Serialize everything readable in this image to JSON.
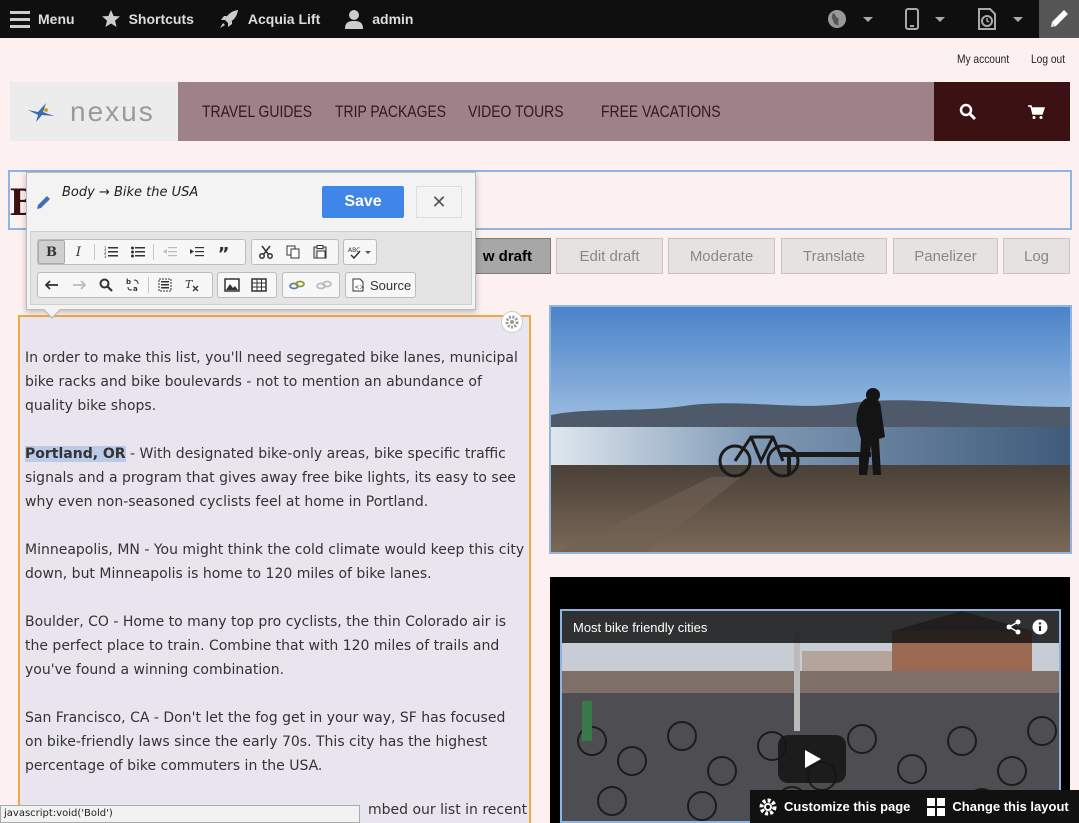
{
  "admin_bar": {
    "menu": "Menu",
    "shortcuts": "Shortcuts",
    "acquia_lift": "Acquia Lift",
    "user": "admin"
  },
  "account": {
    "my_account": "My account",
    "log_out": "Log out"
  },
  "site": {
    "logo": "nexus",
    "nav": [
      "TRAVEL GUIDES",
      "TRIP PACKAGES",
      "VIDEO TOURS",
      "FREE VACATIONS"
    ]
  },
  "page": {
    "title_initial": "B"
  },
  "tabs": {
    "view_draft": "w draft",
    "edit_draft": "Edit draft",
    "moderate": "Moderate",
    "translate": "Translate",
    "panelizer": "Panelizer",
    "log": "Log"
  },
  "editor": {
    "breadcrumb": "Body → Bike the USA",
    "save": "Save",
    "close": "✕",
    "source": "Source"
  },
  "body": {
    "p1": "In order to make this list, you'll need segregated bike lanes, municipal bike racks and bike boulevards - not to mention an abundance of quality bike shops.",
    "p2_highlight": "Portland, OR",
    "p2_rest": " - With designated bike-only areas, bike specific traffic signals and a program that gives away free bike lights, its easy to see why even non-seasoned cyclists feel at home in Portland.",
    "p3": "Minneapolis, MN - You might think the cold climate would keep this city down, but Minneapolis is home to 120 miles of bike lanes.",
    "p4": "Boulder, CO - Home to many top pro cyclists, the thin Colorado air is the perfect place to train. Combine that with 120 miles of trails and you've found a winning combination.",
    "p5": "San Francisco, CA - Don't let the fog get in your way, SF has focused on bike-friendly laws since the early 70s. This city has the highest percentage of bike commuters in the USA.",
    "p6_tail": "mbed our list in recent"
  },
  "video": {
    "title": "Most bike friendly cities"
  },
  "status_bar": "javascript:void('Bold')",
  "customize": {
    "customize_page": "Customize this page",
    "change_layout": "Change this layout"
  }
}
